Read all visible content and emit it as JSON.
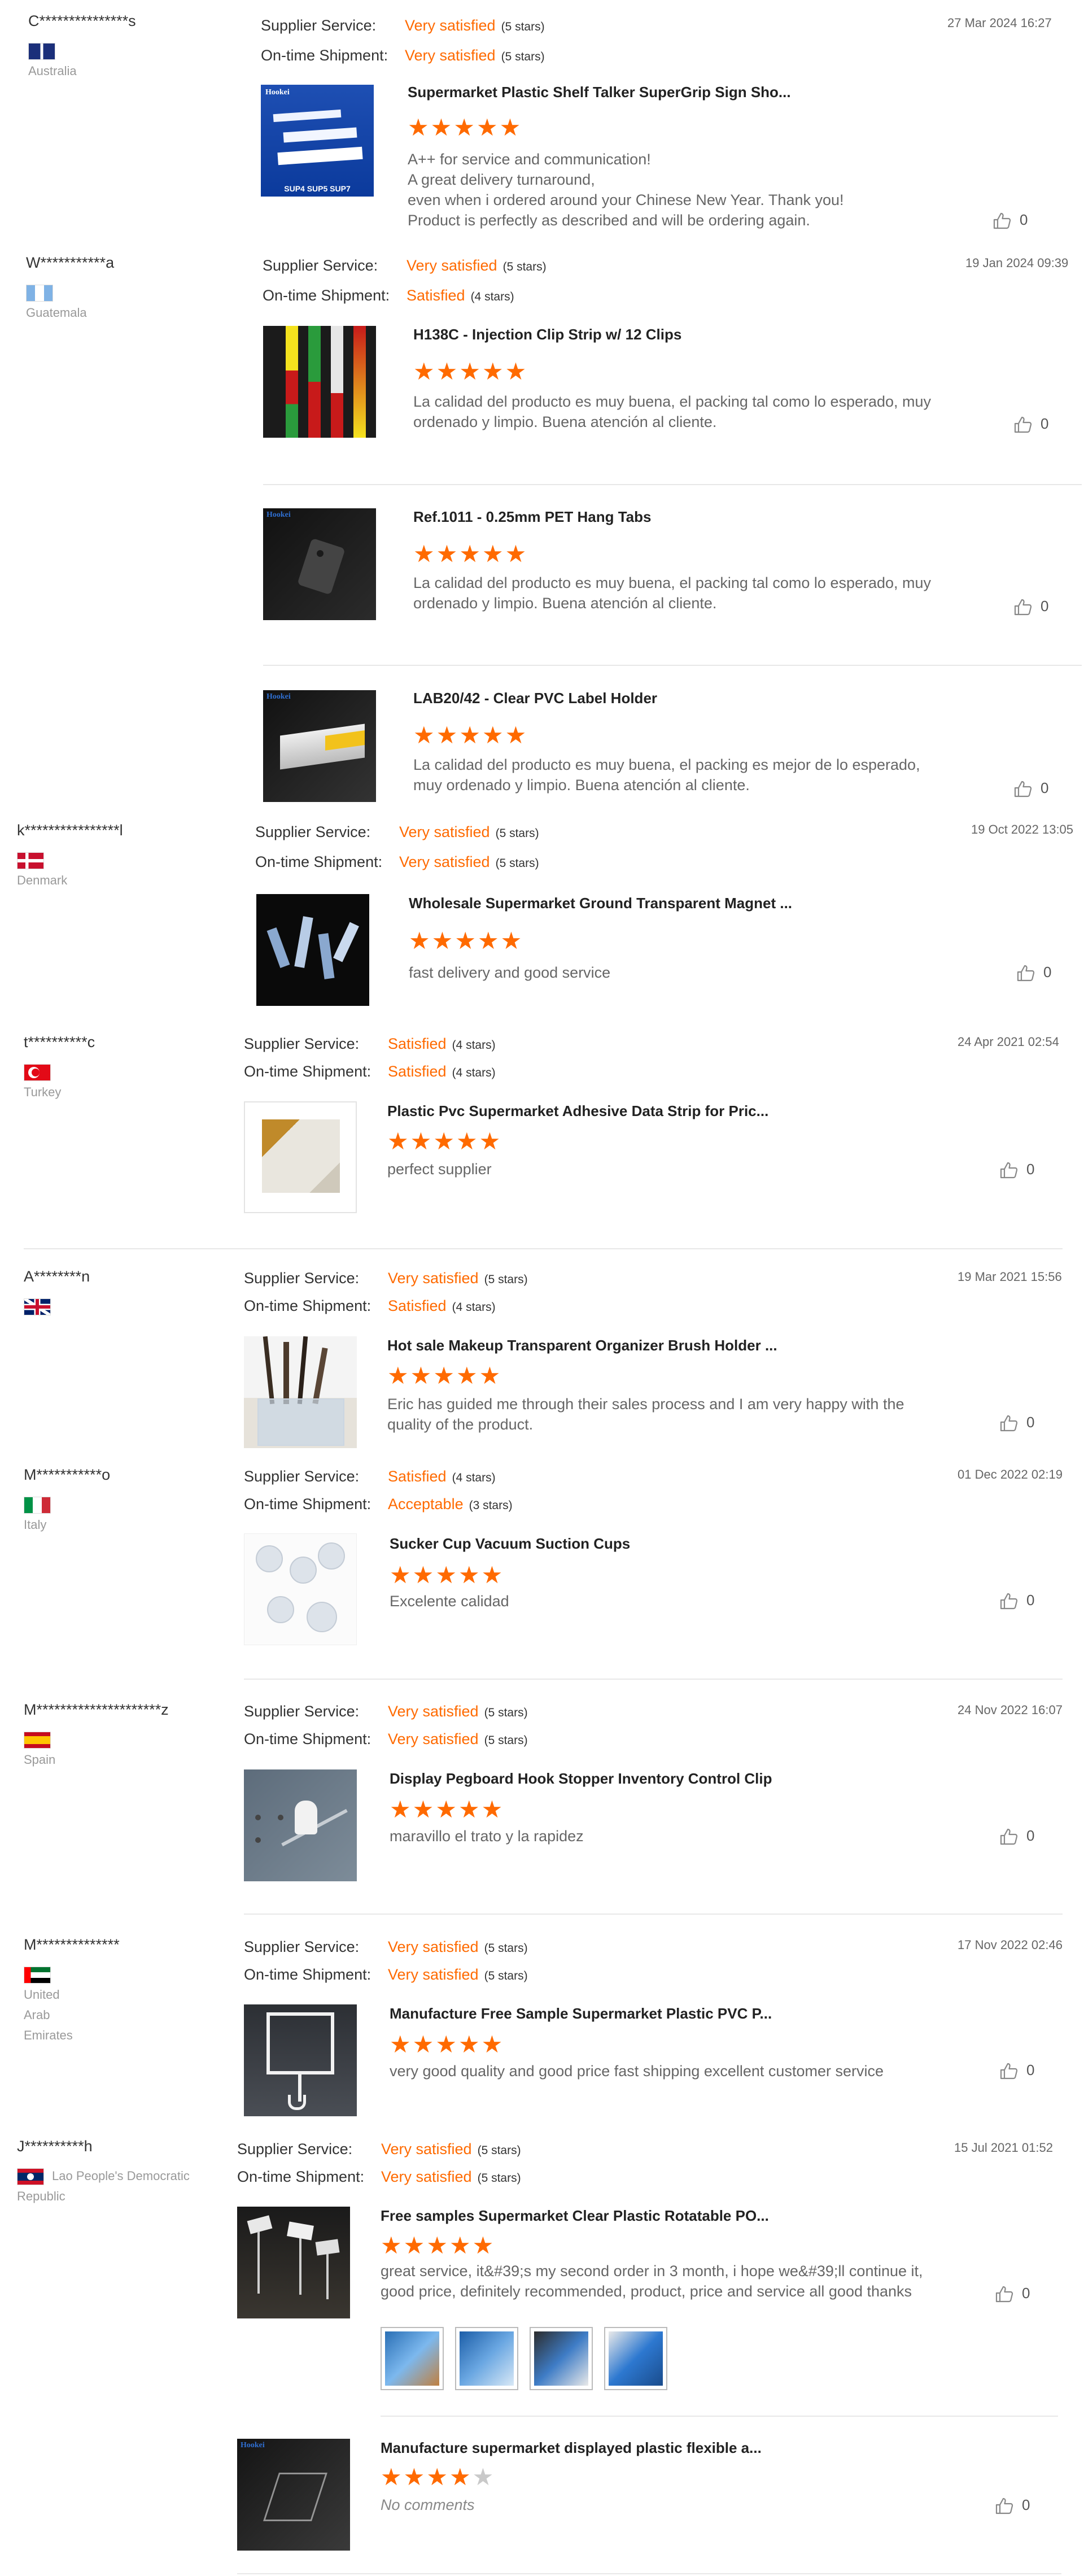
{
  "labels": {
    "supplier_service": "Supplier Service:",
    "on_time_shipment": "On-time Shipment:"
  },
  "reviews": [
    {
      "user": "C***************s",
      "country": "Australia",
      "date": "27 Mar 2024 16:27",
      "supplier_service": "Very satisfied",
      "supplier_service_stars": "(5 stars)",
      "on_time_shipment": "Very satisfied",
      "on_time_shipment_stars": "(5 stars)",
      "products": [
        {
          "title": "Supermarket Plastic Shelf Talker SuperGrip Sign Sho...",
          "rating": 5,
          "comment": "A++ for service and communication!\nA great delivery turnaround,\neven when i ordered around your Chinese New Year. Thank you!\nProduct is perfectly as described and will be ordering again.",
          "likes": "0",
          "thumb_text": "SUP4 SUP5 SUP7"
        }
      ]
    },
    {
      "user": "W***********a",
      "country": "Guatemala",
      "date": "19 Jan 2024 09:39",
      "supplier_service": "Very satisfied",
      "supplier_service_stars": "(5 stars)",
      "on_time_shipment": "Satisfied",
      "on_time_shipment_stars": "(4 stars)",
      "products": [
        {
          "title": "H138C - Injection Clip Strip w/ 12 Clips",
          "rating": 5,
          "comment": "La calidad del producto es muy buena, el packing tal como lo esperado, muy ordenado y limpio. Buena atención al cliente.",
          "likes": "0"
        },
        {
          "title": "Ref.1011 - 0.25mm PET Hang Tabs",
          "rating": 5,
          "comment": "La calidad del producto es muy buena, el packing tal como lo esperado, muy ordenado y limpio. Buena atención al cliente.",
          "likes": "0"
        },
        {
          "title": "LAB20/42 - Clear PVC Label Holder",
          "rating": 5,
          "comment": "La calidad del producto es muy buena, el packing es mejor de lo esperado, muy ordenado y limpio. Buena atención al cliente.",
          "likes": "0"
        }
      ]
    },
    {
      "user": "k****************l",
      "country": "Denmark",
      "date": "19 Oct 2022 13:05",
      "supplier_service": "Very satisfied",
      "supplier_service_stars": "(5 stars)",
      "on_time_shipment": "Very satisfied",
      "on_time_shipment_stars": "(5 stars)",
      "products": [
        {
          "title": "Wholesale Supermarket Ground Transparent Magnet ...",
          "rating": 5,
          "comment": "fast delivery and good service",
          "likes": "0"
        }
      ]
    },
    {
      "user": "t**********c",
      "country": "Turkey",
      "date": "24 Apr 2021 02:54",
      "supplier_service": "Satisfied",
      "supplier_service_stars": "(4 stars)",
      "on_time_shipment": "Satisfied",
      "on_time_shipment_stars": "(4 stars)",
      "products": [
        {
          "title": "Plastic Pvc Supermarket Adhesive Data Strip for Pric...",
          "rating": 5,
          "comment": "perfect supplier",
          "likes": "0"
        }
      ]
    },
    {
      "user": "A********n",
      "country": "",
      "date": "19 Mar 2021 15:56",
      "supplier_service": "Very satisfied",
      "supplier_service_stars": "(5 stars)",
      "on_time_shipment": "Satisfied",
      "on_time_shipment_stars": "(4 stars)",
      "products": [
        {
          "title": "Hot sale Makeup Transparent Organizer Brush Holder ...",
          "rating": 5,
          "comment": "Eric has guided me through their sales process and I am very happy with the quality of the product.",
          "likes": "0"
        }
      ]
    },
    {
      "user": "M***********o",
      "country": "Italy",
      "date": "01 Dec 2022 02:19",
      "supplier_service": "Satisfied",
      "supplier_service_stars": "(4 stars)",
      "on_time_shipment": "Acceptable",
      "on_time_shipment_stars": "(3 stars)",
      "products": [
        {
          "title": "Sucker Cup Vacuum Suction Cups",
          "rating": 5,
          "comment": "Excelente calidad",
          "likes": "0"
        }
      ]
    },
    {
      "user": "M*********************z",
      "country": "Spain",
      "date": "24 Nov 2022 16:07",
      "supplier_service": "Very satisfied",
      "supplier_service_stars": "(5 stars)",
      "on_time_shipment": "Very satisfied",
      "on_time_shipment_stars": "(5 stars)",
      "products": [
        {
          "title": "Display Pegboard Hook Stopper Inventory Control Clip",
          "rating": 5,
          "comment": "maravillo el trato y la rapidez",
          "likes": "0"
        }
      ]
    },
    {
      "user": "M**************",
      "country": "United Arab Emirates",
      "date": "17 Nov 2022 02:46",
      "supplier_service": "Very satisfied",
      "supplier_service_stars": "(5 stars)",
      "on_time_shipment": "Very satisfied",
      "on_time_shipment_stars": "(5 stars)",
      "products": [
        {
          "title": "Manufacture Free Sample Supermarket Plastic PVC P...",
          "rating": 5,
          "comment": "very good quality and good price fast shipping excellent customer service",
          "likes": "0"
        }
      ]
    },
    {
      "user": "J**********h",
      "country": "Lao People's Democratic Republic",
      "date": "15 Jul 2021 01:52",
      "supplier_service": "Very satisfied",
      "supplier_service_stars": "(5 stars)",
      "on_time_shipment": "Very satisfied",
      "on_time_shipment_stars": "(5 stars)",
      "products": [
        {
          "title": "Free samples Supermarket Clear Plastic Rotatable PO...",
          "rating": 5,
          "comment": "great service, it&#39;s my second order in 3 month, i hope we&#39;ll continue it, good price, definitely recommended, product, price and service all good thanks",
          "likes": "0"
        },
        {
          "title": "Manufacture supermarket displayed plastic flexible a...",
          "rating": 4,
          "comment": "No comments",
          "likes": "0"
        }
      ]
    }
  ],
  "colors": {
    "accent": "#ff6a00",
    "text": "#333333",
    "muted": "#999999",
    "star_empty": "#c9c9c9"
  },
  "icons": {
    "like": "thumbs-up-icon",
    "star": "star-icon"
  },
  "brand_logo_text": "Hookei"
}
